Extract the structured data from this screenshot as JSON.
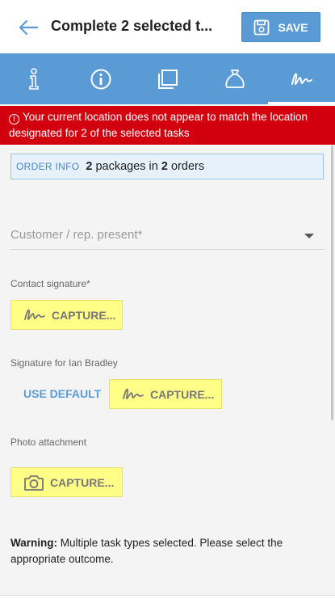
{
  "header": {
    "title": "Complete 2 selected t...",
    "save_label": "SAVE"
  },
  "tabs": [
    {
      "icon": "info-letter-icon",
      "active": false
    },
    {
      "icon": "info-circle-icon",
      "active": false
    },
    {
      "icon": "copy-icon",
      "active": false
    },
    {
      "icon": "bag-icon",
      "active": false
    },
    {
      "icon": "signature-icon",
      "active": true
    }
  ],
  "alert": {
    "text": "Your current location does not appear to match the location designated for 2 of the selected tasks"
  },
  "order_info": {
    "label": "ORDER INFO",
    "packages_count": "2",
    "packages_text": " packages in ",
    "orders_count": "2",
    "orders_text": " orders"
  },
  "customer_select": {
    "placeholder": "Customer / rep. present*"
  },
  "contact_signature": {
    "label": "Contact signature*",
    "capture_label": "CAPTURE..."
  },
  "rep_signature": {
    "label": "Signature for Ian Bradley",
    "use_default_label": "USE DEFAULT",
    "capture_label": "CAPTURE..."
  },
  "photo": {
    "label": "Photo attachment",
    "capture_label": "CAPTURE..."
  },
  "warning": {
    "bold": "Warning:",
    "text": " Multiple task types selected. Please select the appropriate outcome."
  },
  "colors": {
    "accent": "#5b9bd5",
    "alert": "#d2000f",
    "capture": "#ffff88"
  }
}
